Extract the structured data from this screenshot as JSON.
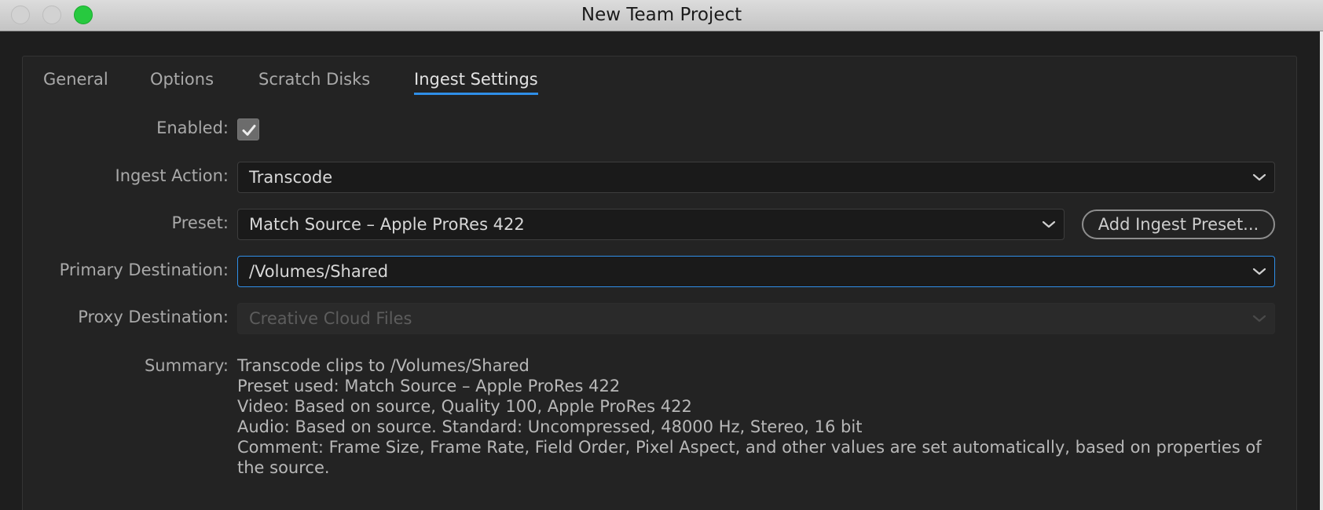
{
  "window": {
    "title": "New Team Project"
  },
  "tabs": [
    {
      "label": "General"
    },
    {
      "label": "Options"
    },
    {
      "label": "Scratch Disks"
    },
    {
      "label": "Ingest Settings",
      "active": true
    }
  ],
  "form": {
    "enabled_label": "Enabled:",
    "enabled_checked": true,
    "ingest_action_label": "Ingest Action:",
    "ingest_action_value": "Transcode",
    "preset_label": "Preset:",
    "preset_value": "Match Source – Apple ProRes 422",
    "add_preset_button": "Add Ingest Preset...",
    "primary_destination_label": "Primary Destination:",
    "primary_destination_value": "/Volumes/Shared",
    "proxy_destination_label": "Proxy Destination:",
    "proxy_destination_value": "Creative Cloud Files",
    "summary_label": "Summary:",
    "summary": [
      "Transcode clips to /Volumes/Shared",
      "Preset used: Match Source – Apple ProRes 422",
      "Video: Based on source, Quality 100, Apple ProRes 422",
      "Audio: Based on source. Standard: Uncompressed, 48000 Hz, Stereo, 16 bit",
      "Comment: Frame Size, Frame Rate, Field Order, Pixel Aspect, and other values are set automatically, based on properties of the source."
    ]
  },
  "colors": {
    "accent": "#2f8fe8",
    "zoom_button": "#27c93f",
    "background": "#232323"
  },
  "icons": [
    "close-button",
    "minimize-button",
    "zoom-button",
    "checkmark-icon",
    "chevron-down-icon"
  ]
}
